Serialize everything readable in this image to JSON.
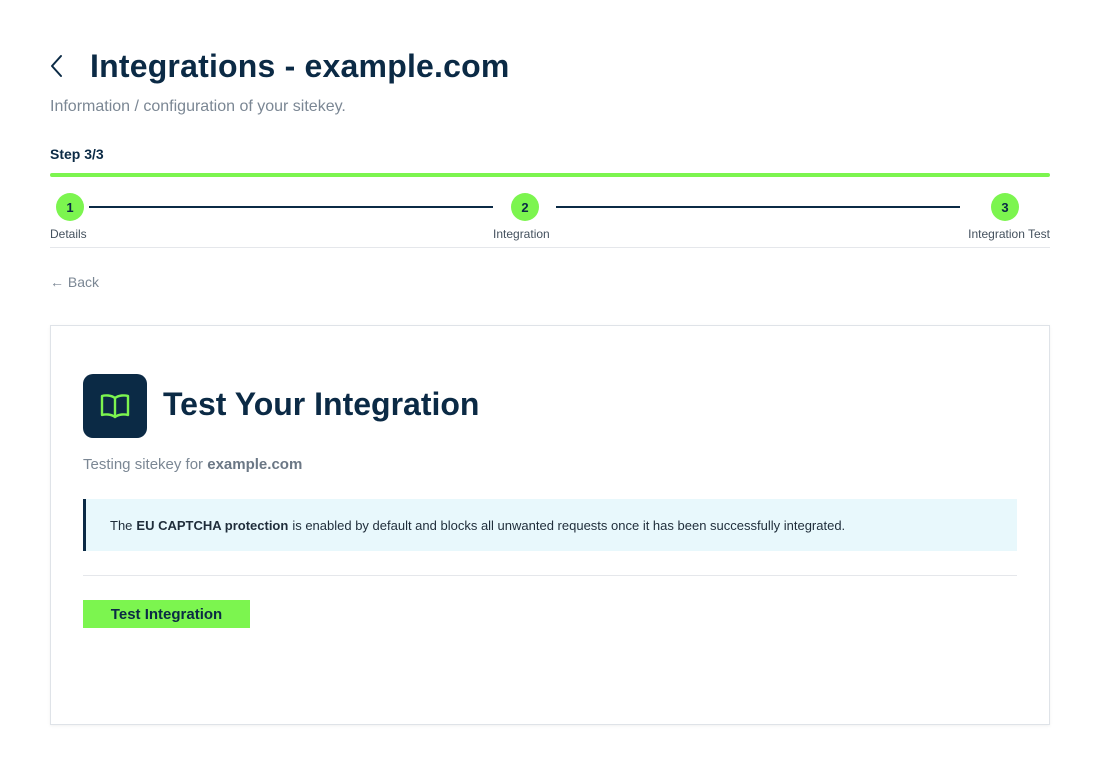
{
  "header": {
    "title": "Integrations - example.com",
    "subtitle": "Information / configuration of your sitekey."
  },
  "step": {
    "label": "Step 3/3",
    "progress": 1.0,
    "steps": [
      {
        "number": "1",
        "name": "Details"
      },
      {
        "number": "2",
        "name": "Integration"
      },
      {
        "number": "3",
        "name": "Integration Test"
      }
    ]
  },
  "back_link": "← Back",
  "card": {
    "icon": "book-open-icon",
    "title": "Test Your Integration",
    "sub_prefix": "Testing sitekey for",
    "sub_domain": "example.com",
    "notice": {
      "before": "The",
      "bold": "EU CAPTCHA protection",
      "after": "is enabled by default and blocks all unwanted requests once it has been successfully integrated."
    },
    "button_label": "Test Integration"
  },
  "colors": {
    "accent_green": "#7cf54f",
    "navy": "#0b2a45",
    "notice_bg": "#e8f8fc"
  }
}
